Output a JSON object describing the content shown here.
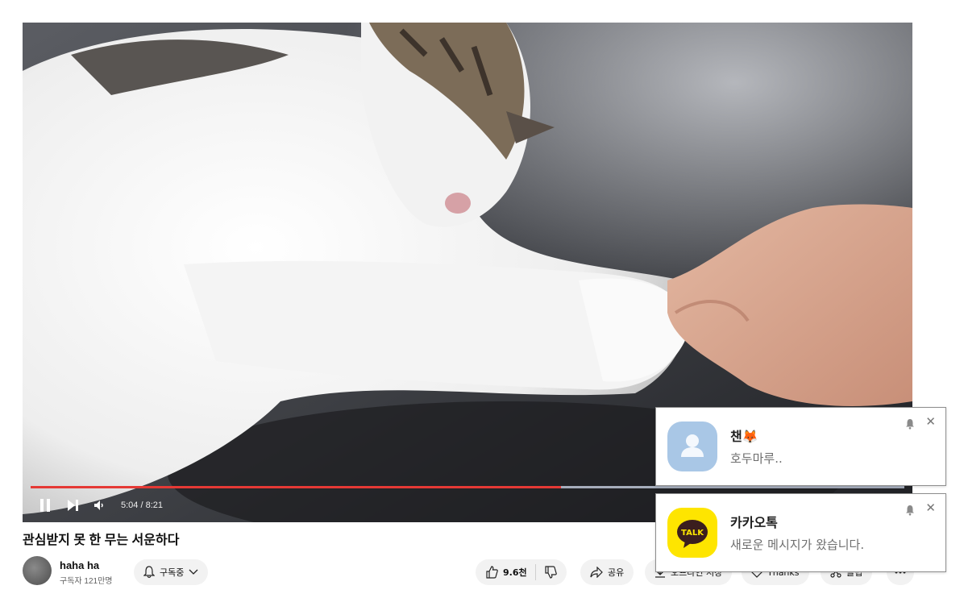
{
  "player": {
    "time": "5:04 / 8:21",
    "progress_fraction": 0.607,
    "buffered_fraction": 1.0
  },
  "video": {
    "title": "관심받지 못 한 무는 서운하다",
    "channel": "haha ha",
    "subscribers": "구독자 121만명",
    "subscribe_label": "구독중",
    "like_count": "9.6천",
    "share_label": "공유",
    "download_label": "오프라인 저장",
    "thanks_label": "Thanks",
    "clip_label": "클립"
  },
  "notifications": [
    {
      "sender": "챈🦊",
      "message": "호두마루..",
      "icon": "person-avatar-icon",
      "icon_color": "#a9c7e6"
    },
    {
      "sender": "카카오톡",
      "message": "새로운 메시지가 왔습니다.",
      "icon": "kakaotalk-logo-icon",
      "icon_text": "TALK",
      "icon_color": "#fee500"
    }
  ]
}
